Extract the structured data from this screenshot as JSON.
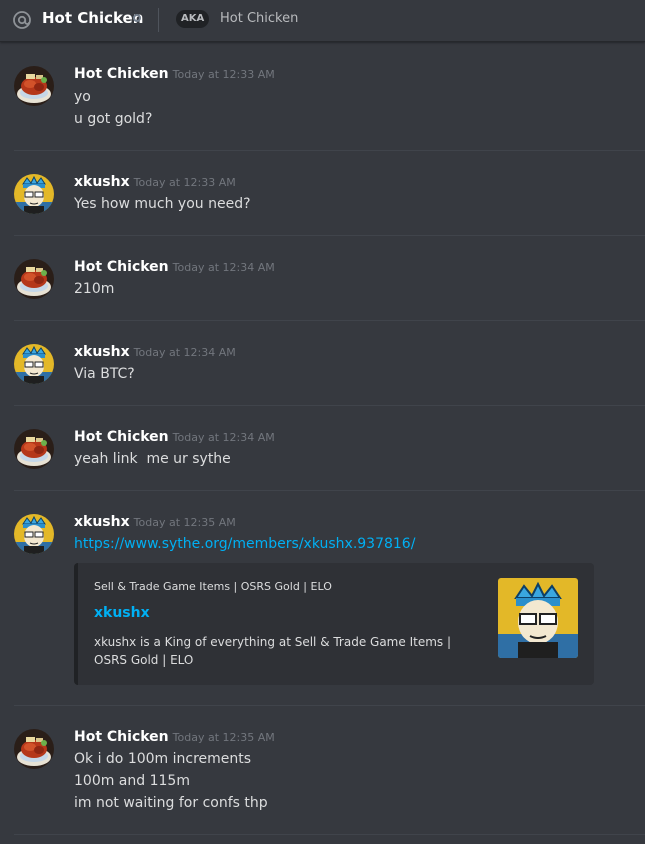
{
  "header": {
    "title": "Hot Chicken",
    "aka_badge": "AKA",
    "aka_name": "Hot Chicken"
  },
  "messages": [
    {
      "author": "Hot Chicken",
      "timestamp": "Today at 12:33 AM",
      "avatar": "hot-chicken-avatar",
      "lines": [
        "yo",
        "u got gold?"
      ]
    },
    {
      "author": "xkushx",
      "timestamp": "Today at 12:33 AM",
      "avatar": "xkushx-avatar",
      "lines": [
        "Yes how much you need?"
      ]
    },
    {
      "author": "Hot Chicken",
      "timestamp": "Today at 12:34 AM",
      "avatar": "hot-chicken-avatar",
      "lines": [
        "210m"
      ]
    },
    {
      "author": "xkushx",
      "timestamp": "Today at 12:34 AM",
      "avatar": "xkushx-avatar",
      "lines": [
        "Via BTC?"
      ]
    },
    {
      "author": "Hot Chicken",
      "timestamp": "Today at 12:34 AM",
      "avatar": "hot-chicken-avatar",
      "lines": [
        "yeah link  me ur sythe"
      ]
    },
    {
      "author": "xkushx",
      "timestamp": "Today at 12:35 AM",
      "avatar": "xkushx-avatar",
      "link": "https://www.sythe.org/members/xkushx.937816/"
    },
    {
      "author": "Hot Chicken",
      "timestamp": "Today at 12:35 AM",
      "avatar": "hot-chicken-avatar",
      "lines": [
        "Ok i do 100m increments",
        "100m and 115m",
        "im not waiting for confs thp"
      ]
    }
  ],
  "embed": {
    "provider": "Sell & Trade Game Items | OSRS Gold | ELO",
    "title": "xkushx",
    "description": "xkushx is a King of everything at Sell & Trade Game Items | OSRS Gold | ELO"
  },
  "colors": {
    "background": "#36393f",
    "link": "#00b0f4",
    "timestamp": "#72767d",
    "embed_bg": "#2f3136"
  }
}
